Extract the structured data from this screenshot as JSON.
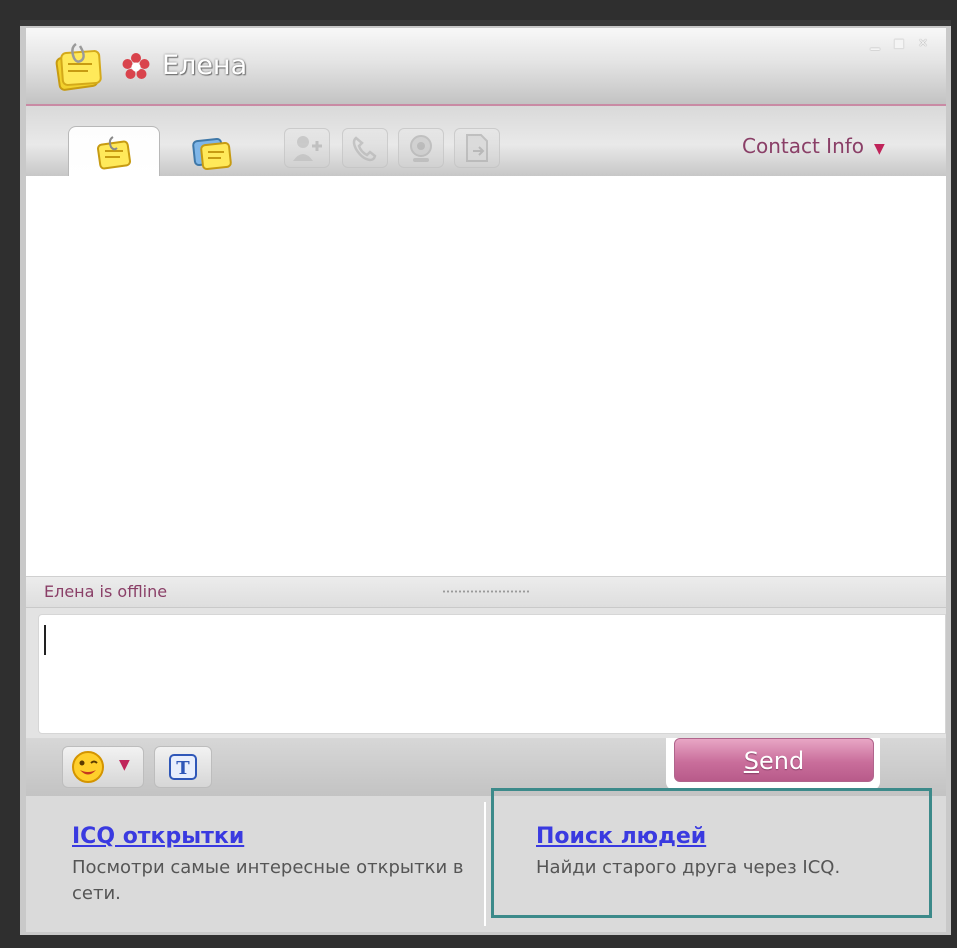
{
  "window": {
    "contact_name": "Елена",
    "controls": {
      "minimize": "minimize-icon",
      "maximize": "maximize-icon",
      "close": "close-icon"
    }
  },
  "toolbar": {
    "tabs": [
      {
        "icon": "message-notes-icon",
        "active": true
      },
      {
        "icon": "multi-chat-notes-icon",
        "active": false
      }
    ],
    "actions": [
      "add-contact-icon",
      "call-icon",
      "webcam-icon",
      "send-file-icon"
    ],
    "contact_info_label": "Contact Info"
  },
  "status": {
    "text": "Елена is offline"
  },
  "compose": {
    "send_label": "end",
    "send_mnemonic": "S",
    "emoticon_icon": "smiley-icon",
    "font_icon": "text-format-icon"
  },
  "footer": {
    "left": {
      "title": "ICQ открытки",
      "desc": "Посмотри самые интересные открытки в сети."
    },
    "right": {
      "title": "Поиск людей",
      "desc": "Найди старого друга через ICQ."
    }
  },
  "colors": {
    "accent_text": "#8a3f67",
    "send_button": "#c96e9b",
    "link": "#3a3ae0",
    "highlight_border": "#3c8a8a"
  }
}
